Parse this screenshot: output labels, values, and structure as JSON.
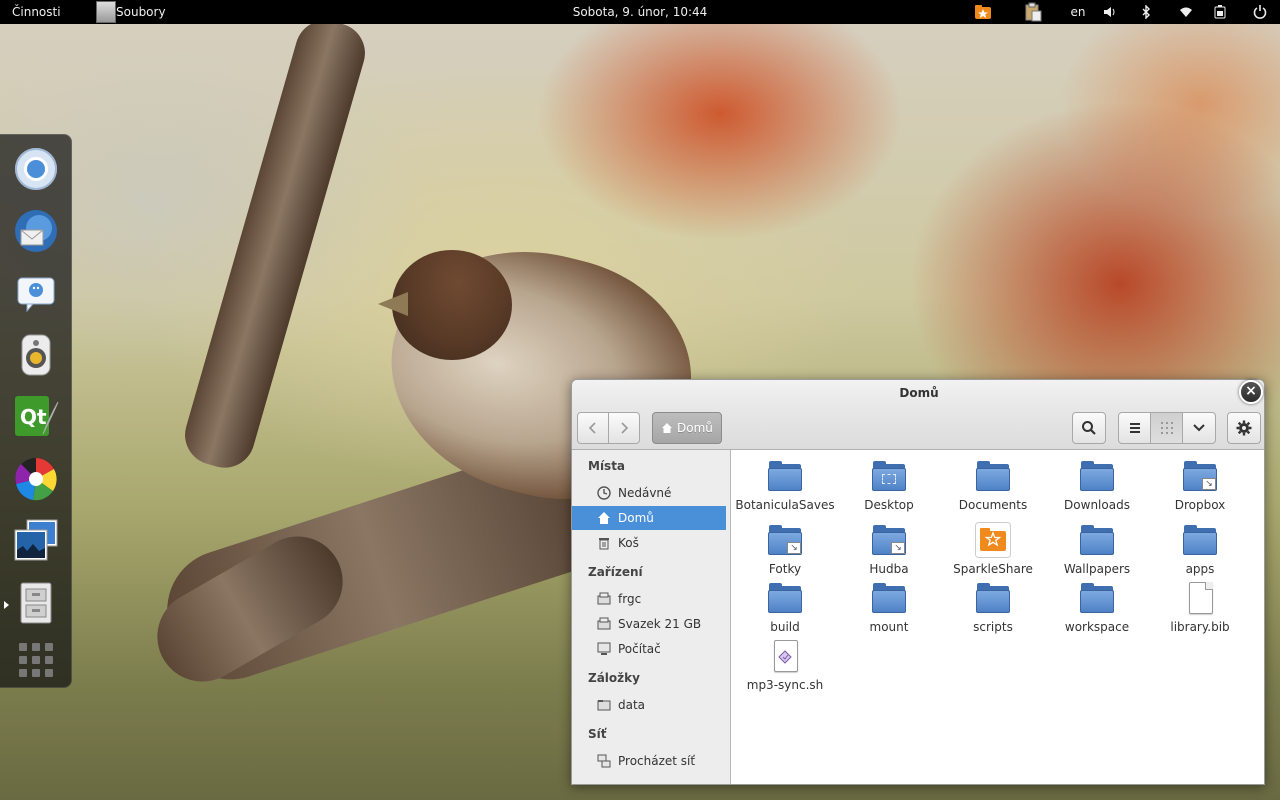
{
  "topbar": {
    "activities": "Činnosti",
    "app_name": "Soubory",
    "clock": "Sobota,  9. únor, 10:44",
    "keyboard_layout": "en",
    "icons": [
      "sparkleshare-icon",
      "clipboard-icon",
      "volume-icon",
      "bluetooth-icon",
      "wifi-icon",
      "battery-icon",
      "power-icon"
    ]
  },
  "dash": {
    "apps": [
      "chromium-icon",
      "thunderbird-icon",
      "empathy-icon",
      "rhythmbox-icon",
      "qt-creator-icon",
      "darktable-icon",
      "shotwell-icon",
      "files-icon"
    ],
    "show_apps": "grid-icon"
  },
  "window": {
    "title": "Domů",
    "path": {
      "current": "Domů"
    },
    "toolbar_icons": [
      "back-icon",
      "forward-icon",
      "search-icon",
      "list-view-icon",
      "grid-view-icon",
      "view-options-icon",
      "settings-icon"
    ]
  },
  "sidebar": {
    "sections": [
      {
        "heading": "Místa",
        "items": [
          {
            "label": "Nedávné",
            "icon": "clock-icon"
          },
          {
            "label": "Domů",
            "icon": "home-icon",
            "selected": true
          },
          {
            "label": "Koš",
            "icon": "trash-icon"
          }
        ]
      },
      {
        "heading": "Zařízení",
        "items": [
          {
            "label": "frgc",
            "icon": "drive-icon"
          },
          {
            "label": "Svazek 21 GB",
            "icon": "drive-icon"
          },
          {
            "label": "Počítač",
            "icon": "computer-icon"
          }
        ]
      },
      {
        "heading": "Záložky",
        "items": [
          {
            "label": "data",
            "icon": "folder-icon"
          }
        ]
      },
      {
        "heading": "Síť",
        "items": [
          {
            "label": "Procházet síť",
            "icon": "network-icon"
          }
        ]
      }
    ]
  },
  "files": [
    {
      "name": "BotaniculaSaves",
      "type": "folder"
    },
    {
      "name": "Desktop",
      "type": "folder-desktop"
    },
    {
      "name": "Documents",
      "type": "folder"
    },
    {
      "name": "Downloads",
      "type": "folder"
    },
    {
      "name": "Dropbox",
      "type": "folder-link"
    },
    {
      "name": "Fotky",
      "type": "folder-link"
    },
    {
      "name": "Hudba",
      "type": "folder-link"
    },
    {
      "name": "SparkleShare",
      "type": "sparkleshare"
    },
    {
      "name": "Wallpapers",
      "type": "folder"
    },
    {
      "name": "apps",
      "type": "folder"
    },
    {
      "name": "build",
      "type": "folder"
    },
    {
      "name": "mount",
      "type": "folder"
    },
    {
      "name": "scripts",
      "type": "folder"
    },
    {
      "name": "workspace",
      "type": "folder"
    },
    {
      "name": "library.bib",
      "type": "text-file"
    },
    {
      "name": "mp3-sync.sh",
      "type": "script-file"
    }
  ],
  "colors": {
    "selection": "#4a90d9",
    "folder": "#5a8bd0",
    "topbar": "#000000"
  }
}
